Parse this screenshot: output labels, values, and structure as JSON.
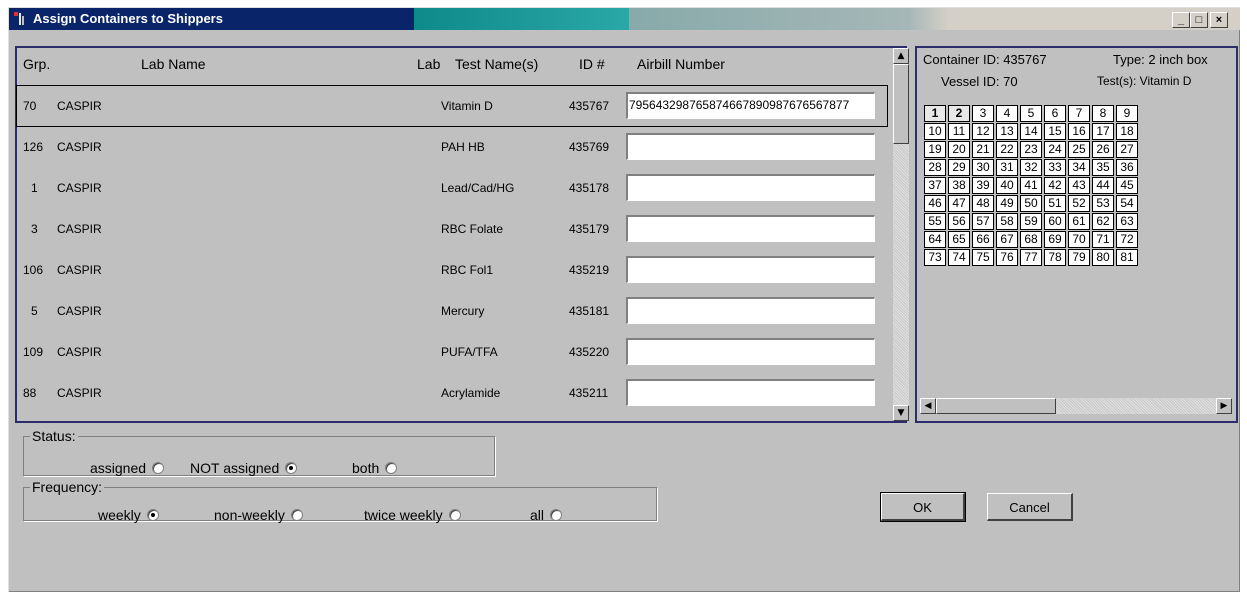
{
  "window": {
    "title": "Assign Containers to Shippers",
    "controls": {
      "minimize": "_",
      "maximize": "□",
      "close": "×"
    }
  },
  "table": {
    "headers": {
      "grp": "Grp.",
      "lab_name": "Lab Name",
      "lab": "Lab",
      "test_names": "Test Name(s)",
      "id": "ID #",
      "airbill": "Airbill Number"
    },
    "rows": [
      {
        "grp": "70",
        "lab_name": "CASPIR",
        "test": "Vitamin D",
        "id": "435767",
        "airbill": "795643298765874667890987676567877",
        "selected": true
      },
      {
        "grp": "126",
        "lab_name": "CASPIR",
        "test": "PAH HB",
        "id": "435769",
        "airbill": ""
      },
      {
        "grp": "1",
        "lab_name": "CASPIR",
        "test": "Lead/Cad/HG",
        "id": "435178",
        "airbill": ""
      },
      {
        "grp": "3",
        "lab_name": "CASPIR",
        "test": "RBC Folate",
        "id": "435179",
        "airbill": ""
      },
      {
        "grp": "106",
        "lab_name": "CASPIR",
        "test": "RBC Fol1",
        "id": "435219",
        "airbill": ""
      },
      {
        "grp": "5",
        "lab_name": "CASPIR",
        "test": "Mercury",
        "id": "435181",
        "airbill": ""
      },
      {
        "grp": "109",
        "lab_name": "CASPIR",
        "test": "PUFA/TFA",
        "id": "435220",
        "airbill": ""
      },
      {
        "grp": "88",
        "lab_name": "CASPIR",
        "test": "Acrylamide",
        "id": "435211",
        "airbill": ""
      }
    ]
  },
  "container": {
    "container_id": "Container ID: 435767",
    "type": "Type: 2 inch box",
    "vessel_id": "Vessel ID: 70",
    "tests": "Test(s): Vitamin D",
    "slots": [
      "1",
      "2",
      "3",
      "4",
      "5",
      "6",
      "7",
      "8",
      "9",
      "10",
      "11",
      "12",
      "13",
      "14",
      "15",
      "16",
      "17",
      "18",
      "19",
      "20",
      "21",
      "22",
      "23",
      "24",
      "25",
      "26",
      "27",
      "28",
      "29",
      "30",
      "31",
      "32",
      "33",
      "34",
      "35",
      "36",
      "37",
      "38",
      "39",
      "40",
      "41",
      "42",
      "43",
      "44",
      "45",
      "46",
      "47",
      "48",
      "49",
      "50",
      "51",
      "52",
      "53",
      "54",
      "55",
      "56",
      "57",
      "58",
      "59",
      "60",
      "61",
      "62",
      "63",
      "64",
      "65",
      "66",
      "67",
      "68",
      "69",
      "70",
      "71",
      "72",
      "73",
      "74",
      "75",
      "76",
      "77",
      "78",
      "79",
      "80",
      "81"
    ],
    "filled_slots": [
      "1",
      "2"
    ]
  },
  "status": {
    "legend": "Status:",
    "options": [
      {
        "label": "assigned",
        "checked": false
      },
      {
        "label": "NOT assigned",
        "checked": true
      },
      {
        "label": "both",
        "checked": false
      }
    ]
  },
  "frequency": {
    "legend": "Frequency:",
    "options": [
      {
        "label": "weekly",
        "checked": true
      },
      {
        "label": "non-weekly",
        "checked": false
      },
      {
        "label": "twice weekly",
        "checked": false
      },
      {
        "label": "all",
        "checked": false
      }
    ]
  },
  "buttons": {
    "ok": "OK",
    "cancel": "Cancel"
  },
  "scroll_icons": {
    "up": "▲",
    "down": "▼",
    "left": "◀",
    "right": "▶"
  }
}
